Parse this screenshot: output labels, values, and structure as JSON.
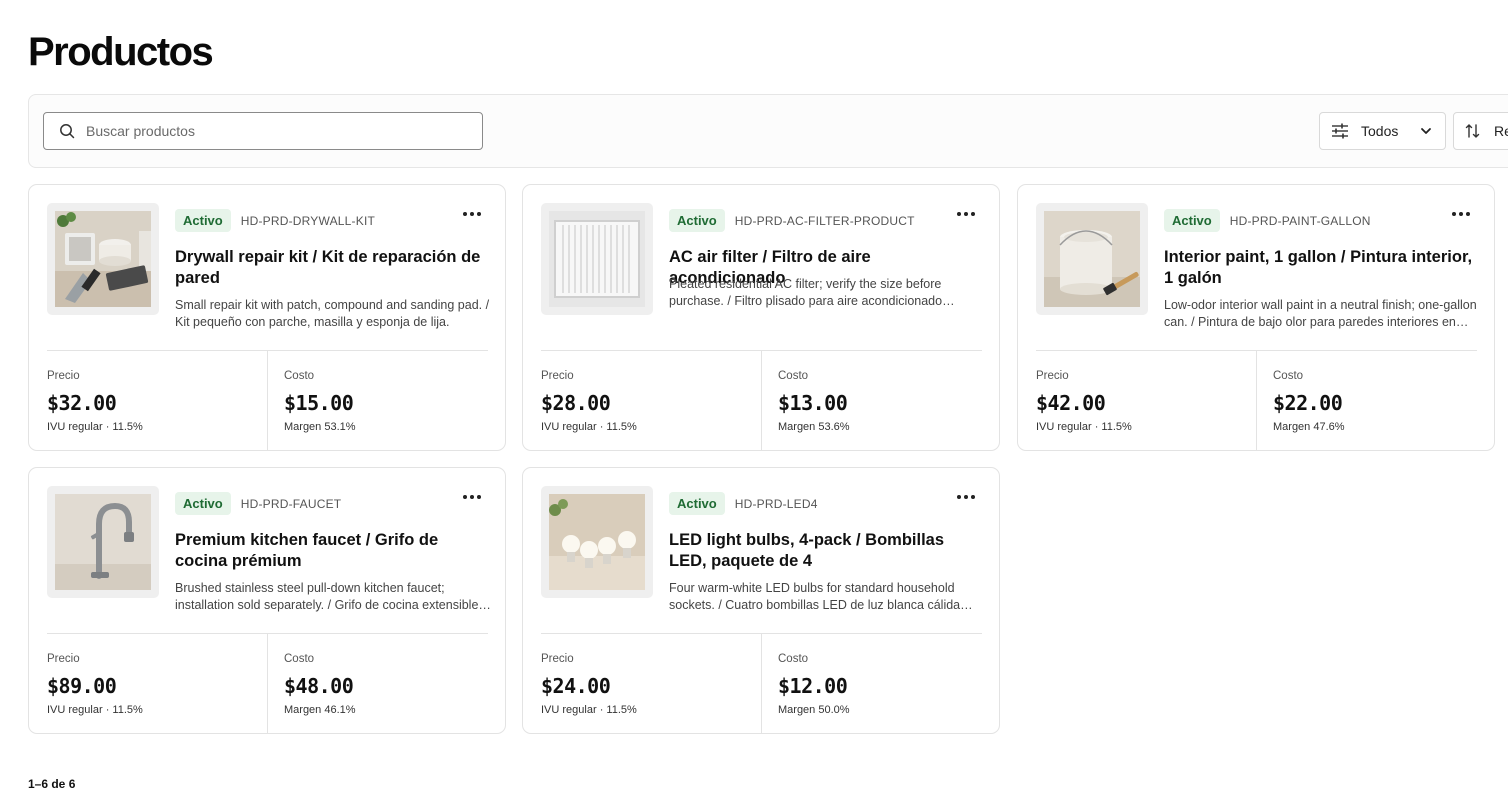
{
  "page": {
    "title": "Productos"
  },
  "toolbar": {
    "search_placeholder": "Buscar productos",
    "filter_label": "Todos",
    "sort_label": "Re"
  },
  "labels": {
    "price": "Precio",
    "cost": "Costo"
  },
  "products": [
    {
      "status": "Activo",
      "sku": "HD-PRD-DRYWALL-KIT",
      "name": "Drywall repair kit / Kit de reparación de pared",
      "description": "Small repair kit with patch, compound and sanding pad. / Kit pequeño con parche, masilla y esponja de lija.",
      "price": "$32.00",
      "tax": "IVU regular · 11.5%",
      "cost": "$15.00",
      "margin": "Margen 53.1%",
      "image": "drywall-kit-photo"
    },
    {
      "status": "Activo",
      "sku": "HD-PRD-AC-FILTER-PRODUCT",
      "name": "AC air filter / Filtro de aire acondicionado",
      "description": "Pleated residential AC filter; verify the size before purchase. / Filtro plisado para aire acondicionado residencial; verifique el tamaño.",
      "price": "$28.00",
      "tax": "IVU regular · 11.5%",
      "cost": "$13.00",
      "margin": "Margen 53.6%",
      "image": "ac-filter-photo"
    },
    {
      "status": "Activo",
      "sku": "HD-PRD-PAINT-GALLON",
      "name": "Interior paint, 1 gallon / Pintura interior, 1 galón",
      "description": "Low-odor interior wall paint in a neutral finish; one-gallon can. / Pintura de bajo olor para paredes interiores en acabado neutro.",
      "price": "$42.00",
      "tax": "IVU regular · 11.5%",
      "cost": "$22.00",
      "margin": "Margen 47.6%",
      "image": "paint-can-photo"
    },
    {
      "status": "Activo",
      "sku": "HD-PRD-FAUCET",
      "name": "Premium kitchen faucet / Grifo de cocina prémium",
      "description": "Brushed stainless steel pull-down kitchen faucet; installation sold separately. / Grifo de cocina extensible de acero inoxidable.",
      "price": "$89.00",
      "tax": "IVU regular · 11.5%",
      "cost": "$48.00",
      "margin": "Margen 46.1%",
      "image": "faucet-photo"
    },
    {
      "status": "Activo",
      "sku": "HD-PRD-LED4",
      "name": "LED light bulbs, 4-pack / Bombillas LED, paquete de 4",
      "description": "Four warm-white LED bulbs for standard household sockets. / Cuatro bombillas LED de luz blanca cálida para uso doméstico.",
      "price": "$24.00",
      "tax": "IVU regular · 11.5%",
      "cost": "$12.00",
      "margin": "Margen 50.0%",
      "image": "led-bulbs-photo"
    }
  ],
  "pagination": {
    "summary": "1–6 de 6"
  }
}
